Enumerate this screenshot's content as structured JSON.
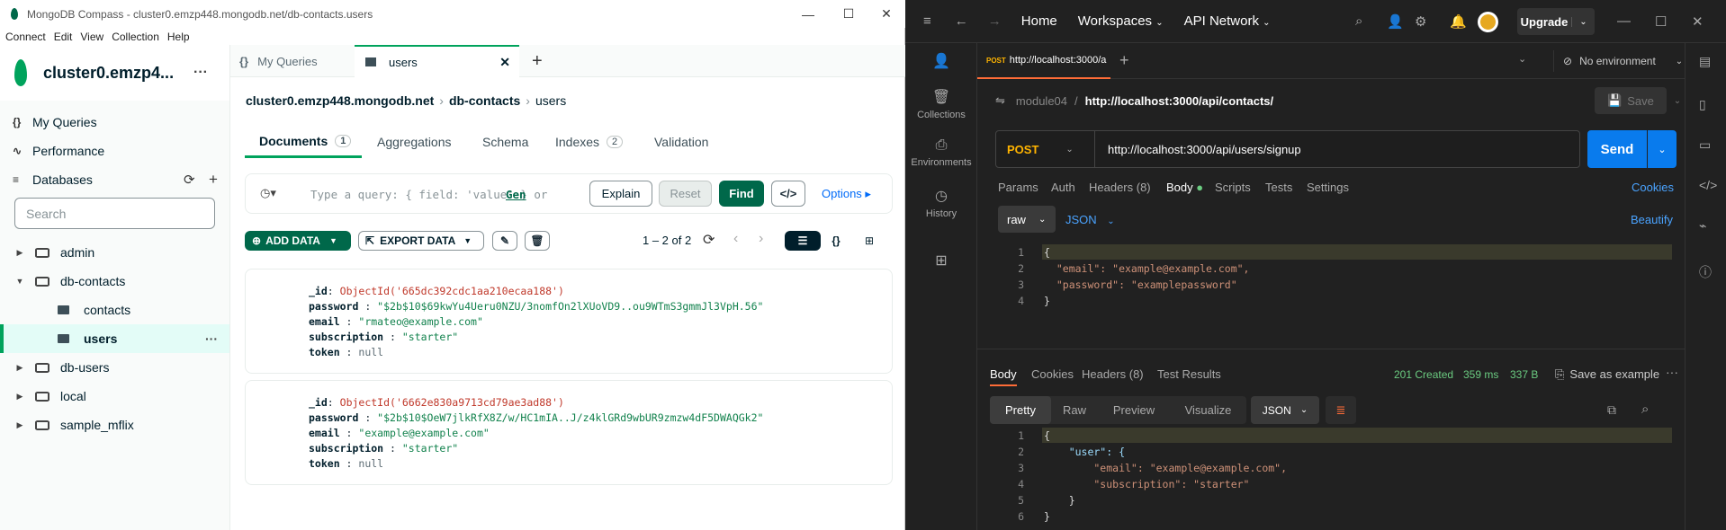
{
  "compass": {
    "window_title": "MongoDB Compass - cluster0.emzp448.mongodb.net/db-contacts.users",
    "menu": [
      "Connect",
      "Edit",
      "View",
      "Collection",
      "Help"
    ],
    "cluster_name": "cluster0.emzp4...",
    "sidebar": {
      "my_queries": "My Queries",
      "performance": "Performance",
      "databases": "Databases",
      "search_placeholder": "Search",
      "tree": [
        {
          "label": "admin"
        },
        {
          "label": "db-contacts"
        },
        {
          "label": "contacts"
        },
        {
          "label": "users"
        },
        {
          "label": "db-users"
        },
        {
          "label": "local"
        },
        {
          "label": "sample_mflix"
        }
      ]
    },
    "tabs": {
      "my_queries": "My Queries",
      "users": "users",
      "add": "+"
    },
    "breadcrumb": {
      "cluster": "cluster0.emzp448.mongodb.net",
      "db": "db-contacts",
      "coll": "users"
    },
    "subtabs": {
      "documents": "Documents",
      "documents_count": "1",
      "aggregations": "Aggregations",
      "schema": "Schema",
      "indexes": "Indexes",
      "indexes_count": "2",
      "validation": "Validation"
    },
    "query": {
      "placeholder": "Type a query: { field: 'value' } or",
      "generate": "Gen",
      "explain": "Explain",
      "reset": "Reset",
      "find": "Find",
      "options": "Options"
    },
    "actions": {
      "add_data": "ADD DATA",
      "export_data": "EXPORT DATA",
      "pagination": "1 – 2 of 2"
    },
    "docs": [
      {
        "id_val": "ObjectId('665dc392cdc1aa210ecaa188')",
        "password": "\"$2b$10$69kwYu4Ueru0NZU/3nomfOn2lXUoVD9..ou9WTmS3gmmJl3VpH.56\"",
        "email": "\"rmateo@example.com\"",
        "subscription": "\"starter\"",
        "token": "null"
      },
      {
        "id_val": "ObjectId('6662e830a9713cd79ae3ad88')",
        "password": "\"$2b$10$OeW7jlkRfX8Z/w/HC1mIA..J/z4klGRd9wbUR9zmzw4dF5DWAQGk2\"",
        "email": "\"example@example.com\"",
        "subscription": "\"starter\"",
        "token": "null"
      }
    ],
    "keys": {
      "id": "_id",
      "password": "password",
      "email": "email",
      "subscription": "subscription",
      "token": "token"
    }
  },
  "postman": {
    "nav": {
      "home": "Home",
      "workspaces": "Workspaces",
      "api_network": "API Network",
      "upgrade": "Upgrade"
    },
    "left": {
      "collections": "Collections",
      "environments": "Environments",
      "history": "History"
    },
    "tab": {
      "method": "POST",
      "label": "http://localhost:3000/a"
    },
    "env": "No environment",
    "crumb": {
      "collection": "module04",
      "sep": "/",
      "request": "http://localhost:3000/api/contacts/"
    },
    "save": "Save",
    "request": {
      "method": "POST",
      "url": "http://localhost:3000/api/users/signup",
      "send": "Send"
    },
    "req_tabs": {
      "params": "Params",
      "auth": "Auth",
      "headers": "Headers (8)",
      "body": "Body",
      "scripts": "Scripts",
      "tests": "Tests",
      "settings": "Settings",
      "cookies": "Cookies"
    },
    "body_mode": {
      "raw": "raw",
      "json": "JSON",
      "beautify": "Beautify"
    },
    "req_lines": [
      "{",
      "  \"email\": \"example@example.com\",",
      "  \"password\": \"examplepassword\"",
      "}"
    ],
    "resp_tabs": {
      "body": "Body",
      "cookies": "Cookies",
      "headers": "Headers (8)",
      "test_results": "Test Results"
    },
    "status": {
      "code": "201 Created",
      "time": "359 ms",
      "size": "337 B",
      "save_example": "Save as example"
    },
    "resp_view": {
      "pretty": "Pretty",
      "raw": "Raw",
      "preview": "Preview",
      "visualize": "Visualize",
      "json": "JSON"
    },
    "resp_lines": [
      "{",
      "    \"user\": {",
      "        \"email\": \"example@example.com\",",
      "        \"subscription\": \"starter\"",
      "    }",
      "}"
    ]
  }
}
